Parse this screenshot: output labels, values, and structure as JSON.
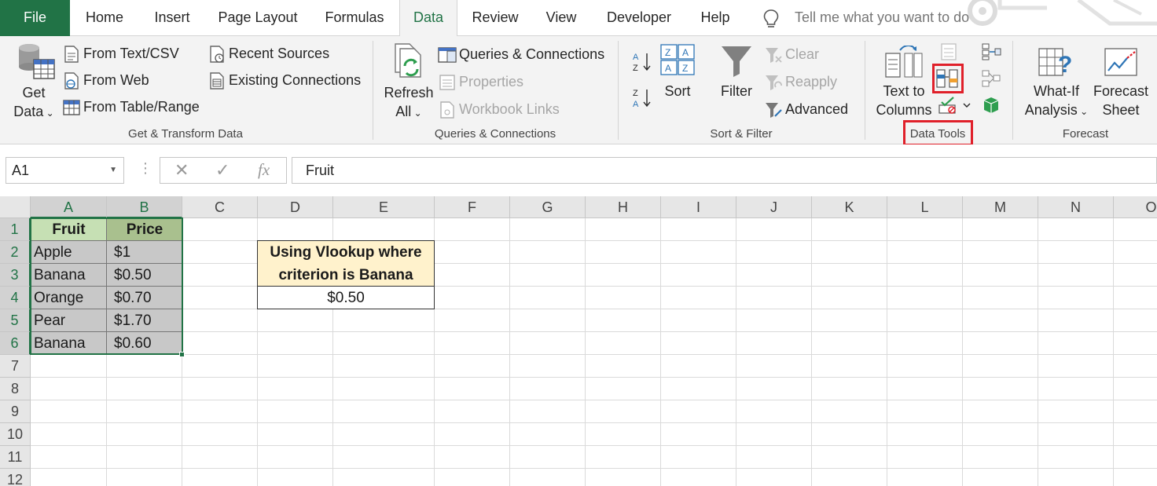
{
  "tabs": [
    {
      "label": "File",
      "name": "tab-file"
    },
    {
      "label": "Home",
      "name": "tab-home"
    },
    {
      "label": "Insert",
      "name": "tab-insert"
    },
    {
      "label": "Page Layout",
      "name": "tab-page-layout"
    },
    {
      "label": "Formulas",
      "name": "tab-formulas"
    },
    {
      "label": "Data",
      "name": "tab-data"
    },
    {
      "label": "Review",
      "name": "tab-review"
    },
    {
      "label": "View",
      "name": "tab-view"
    },
    {
      "label": "Developer",
      "name": "tab-developer"
    },
    {
      "label": "Help",
      "name": "tab-help"
    }
  ],
  "tell_me": "Tell me what you want to do",
  "ribbon": {
    "get_transform": {
      "get_data_1": "Get",
      "get_data_2": "Data",
      "from_text_csv": "From Text/CSV",
      "from_web": "From Web",
      "from_table_range": "From Table/Range",
      "recent_sources": "Recent Sources",
      "existing_connections": "Existing Connections",
      "label": "Get & Transform Data"
    },
    "queries": {
      "refresh_1": "Refresh",
      "refresh_2": "All",
      "queries_connections": "Queries & Connections",
      "properties": "Properties",
      "workbook_links": "Workbook Links",
      "label": "Queries & Connections"
    },
    "sort_filter": {
      "sort": "Sort",
      "filter": "Filter",
      "clear": "Clear",
      "reapply": "Reapply",
      "advanced": "Advanced",
      "label": "Sort & Filter"
    },
    "data_tools": {
      "text_to_1": "Text to",
      "text_to_2": "Columns",
      "label": "Data Tools"
    },
    "forecast": {
      "what_if_1": "What-If",
      "what_if_2": "Analysis",
      "forecast_sheet_1": "Forecast",
      "forecast_sheet_2": "Sheet",
      "label": "Forecast"
    }
  },
  "formula_bar": {
    "name_box": "A1",
    "content": "Fruit"
  },
  "columns": [
    "A",
    "B",
    "C",
    "D",
    "E",
    "F",
    "G",
    "H",
    "I",
    "J",
    "K",
    "L",
    "M",
    "N",
    "O"
  ],
  "rows": [
    "1",
    "2",
    "3",
    "4",
    "5",
    "6",
    "7",
    "8",
    "9",
    "10",
    "11",
    "12"
  ],
  "table": {
    "headers": [
      "Fruit",
      "Price"
    ],
    "rows": [
      [
        "Apple",
        "$1"
      ],
      [
        "Banana",
        "$0.50"
      ],
      [
        "Orange",
        "$0.70"
      ],
      [
        "Pear",
        "$1.70"
      ],
      [
        "Banana",
        "$0.60"
      ]
    ]
  },
  "lookup": {
    "title_1": "Using Vlookup where",
    "title_2": "criterion is Banana",
    "result": "$0.50"
  },
  "colors": {
    "excel_green": "#217346",
    "header_green_light": "#c6e0b4",
    "header_green_dark": "#a9c08e",
    "data_gray": "#c8c8c8",
    "lookup_title_bg": "#fff2cc",
    "highlight_red": "#e0202a"
  }
}
